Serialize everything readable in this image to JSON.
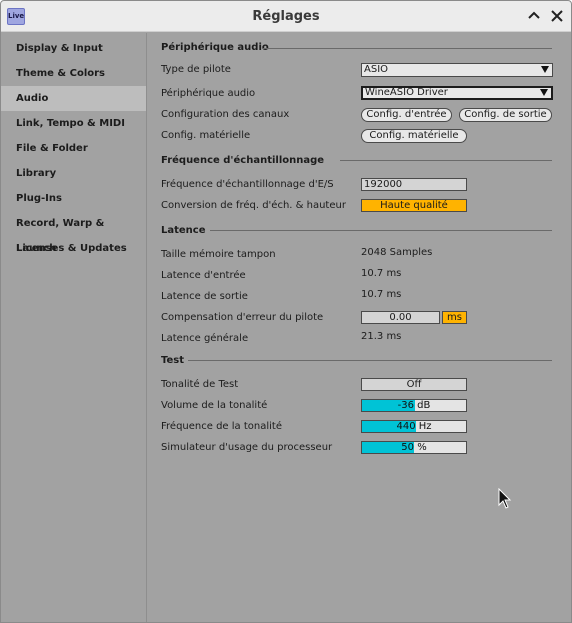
{
  "window": {
    "title": "Réglages",
    "logo_text": "Live"
  },
  "sidebar": {
    "items": [
      {
        "label": "Display & Input"
      },
      {
        "label": "Theme & Colors"
      },
      {
        "label": "Audio",
        "active": true
      },
      {
        "label": "Link, Tempo & MIDI"
      },
      {
        "label": "File & Folder"
      },
      {
        "label": "Library"
      },
      {
        "label": "Plug-Ins"
      },
      {
        "label": "Record, Warp & Launch"
      },
      {
        "label": "Licenses & Updates"
      }
    ]
  },
  "device": {
    "title": "Périphérique audio",
    "driver_type_label": "Type de pilote",
    "driver_type_value": "ASIO",
    "audio_device_label": "Périphérique audio",
    "audio_device_value": "WineASIO Driver",
    "channel_config_label": "Configuration des canaux",
    "input_config_button": "Config. d'entrée",
    "output_config_button": "Config. de sortie",
    "hardware_config_label": "Config. matérielle",
    "hardware_config_button": "Config. matérielle"
  },
  "sample_rate": {
    "title": "Fréquence d'échantillonnage",
    "io_rate_label": "Fréquence d'échantillonnage d'E/S",
    "io_rate_value": "192000",
    "conversion_label": "Conversion de fréq. d'éch. & hauteur",
    "conversion_value": "Haute qualité"
  },
  "latency": {
    "title": "Latence",
    "buffer_label": "Taille mémoire tampon",
    "buffer_value": "2048 Samples",
    "input_label": "Latence d'entrée",
    "input_value": "10.7 ms",
    "output_label": "Latence de sortie",
    "output_value": "10.7 ms",
    "compensation_label": "Compensation d'erreur du pilote",
    "compensation_value": "0.00",
    "compensation_unit": "ms",
    "overall_label": "Latence générale",
    "overall_value": "21.3 ms"
  },
  "test": {
    "title": "Test",
    "tone_label": "Tonalité de Test",
    "tone_value": "Off",
    "volume_label": "Volume de la tonalité",
    "volume_value": "-36 dB",
    "volume_fill": 0.51,
    "frequency_label": "Fréquence de la tonalité",
    "frequency_value": "440 Hz",
    "frequency_fill": 0.52,
    "cpu_label": "Simulateur d'usage du processeur",
    "cpu_value": "50 %",
    "cpu_fill": 0.5
  },
  "colors": {
    "accent_orange": "#ffb300",
    "slider_cyan": "#00c3d6",
    "active_sidebar": "#bdbdbd"
  }
}
